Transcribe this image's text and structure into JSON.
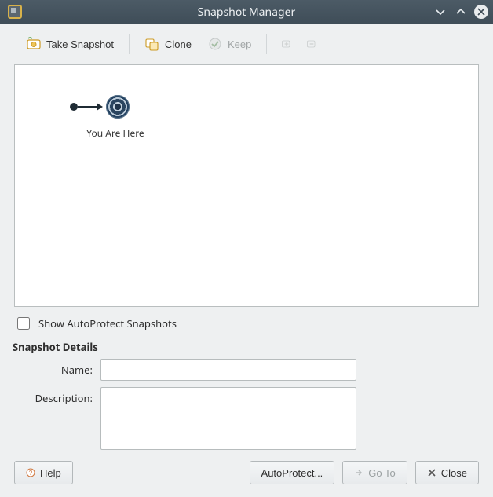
{
  "window": {
    "title": "Snapshot Manager"
  },
  "toolbar": {
    "take_snapshot": "Take Snapshot",
    "clone": "Clone",
    "keep": "Keep"
  },
  "tree": {
    "current_label": "You Are Here"
  },
  "show_autoprotect": {
    "label": "Show AutoProtect Snapshots",
    "checked": false
  },
  "details": {
    "header": "Snapshot Details",
    "name_label": "Name:",
    "name_value": "",
    "description_label": "Description:",
    "description_value": ""
  },
  "buttons": {
    "help": "Help",
    "autoprotect": "AutoProtect...",
    "goto": "Go To",
    "close": "Close"
  }
}
